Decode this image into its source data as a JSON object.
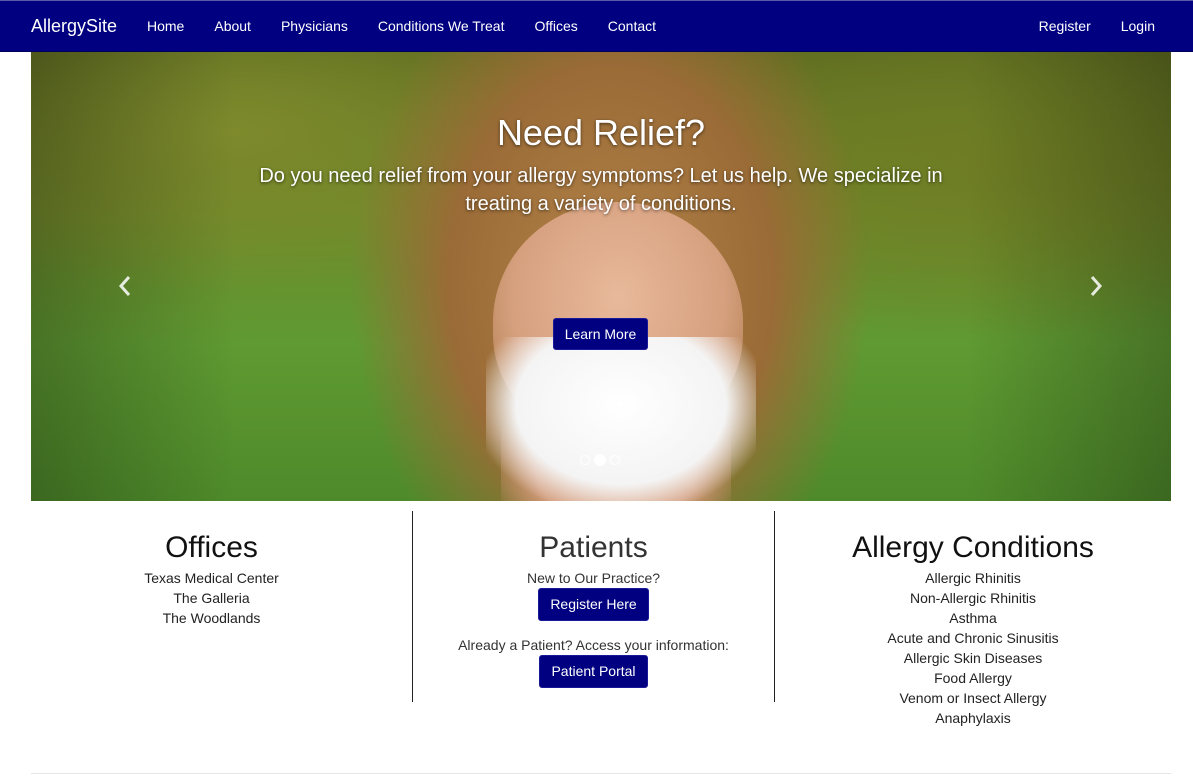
{
  "navbar": {
    "brand": "AllergySite",
    "links": [
      "Home",
      "About",
      "Physicians",
      "Conditions We Treat",
      "Offices",
      "Contact"
    ],
    "right_links": [
      "Register",
      "Login"
    ],
    "bg_color": "#000080"
  },
  "hero": {
    "title": "Need Relief?",
    "text": "Do you need relief from your allergy symptoms? Let us help. We specialize in treating a variety of conditions.",
    "button": "Learn More",
    "prev_icon": "chevron-left-icon",
    "next_icon": "chevron-right-icon",
    "active_slide": 2,
    "slide_count": 3
  },
  "offices": {
    "title": "Offices",
    "items": [
      "Texas Medical Center",
      "The Galleria",
      "The Woodlands"
    ]
  },
  "patients": {
    "title": "Patients",
    "new_text": "New to Our Practice?",
    "register_button": "Register Here",
    "existing_text": "Already a Patient? Access your information:",
    "portal_button": "Patient Portal"
  },
  "conditions": {
    "title": "Allergy Conditions",
    "items": [
      "Allergic Rhinitis",
      "Non-Allergic Rhinitis",
      "Asthma",
      "Acute and Chronic Sinusitis",
      "Allergic Skin Diseases",
      "Food Allergy",
      "Venom or Insect Allergy",
      "Anaphylaxis"
    ]
  }
}
